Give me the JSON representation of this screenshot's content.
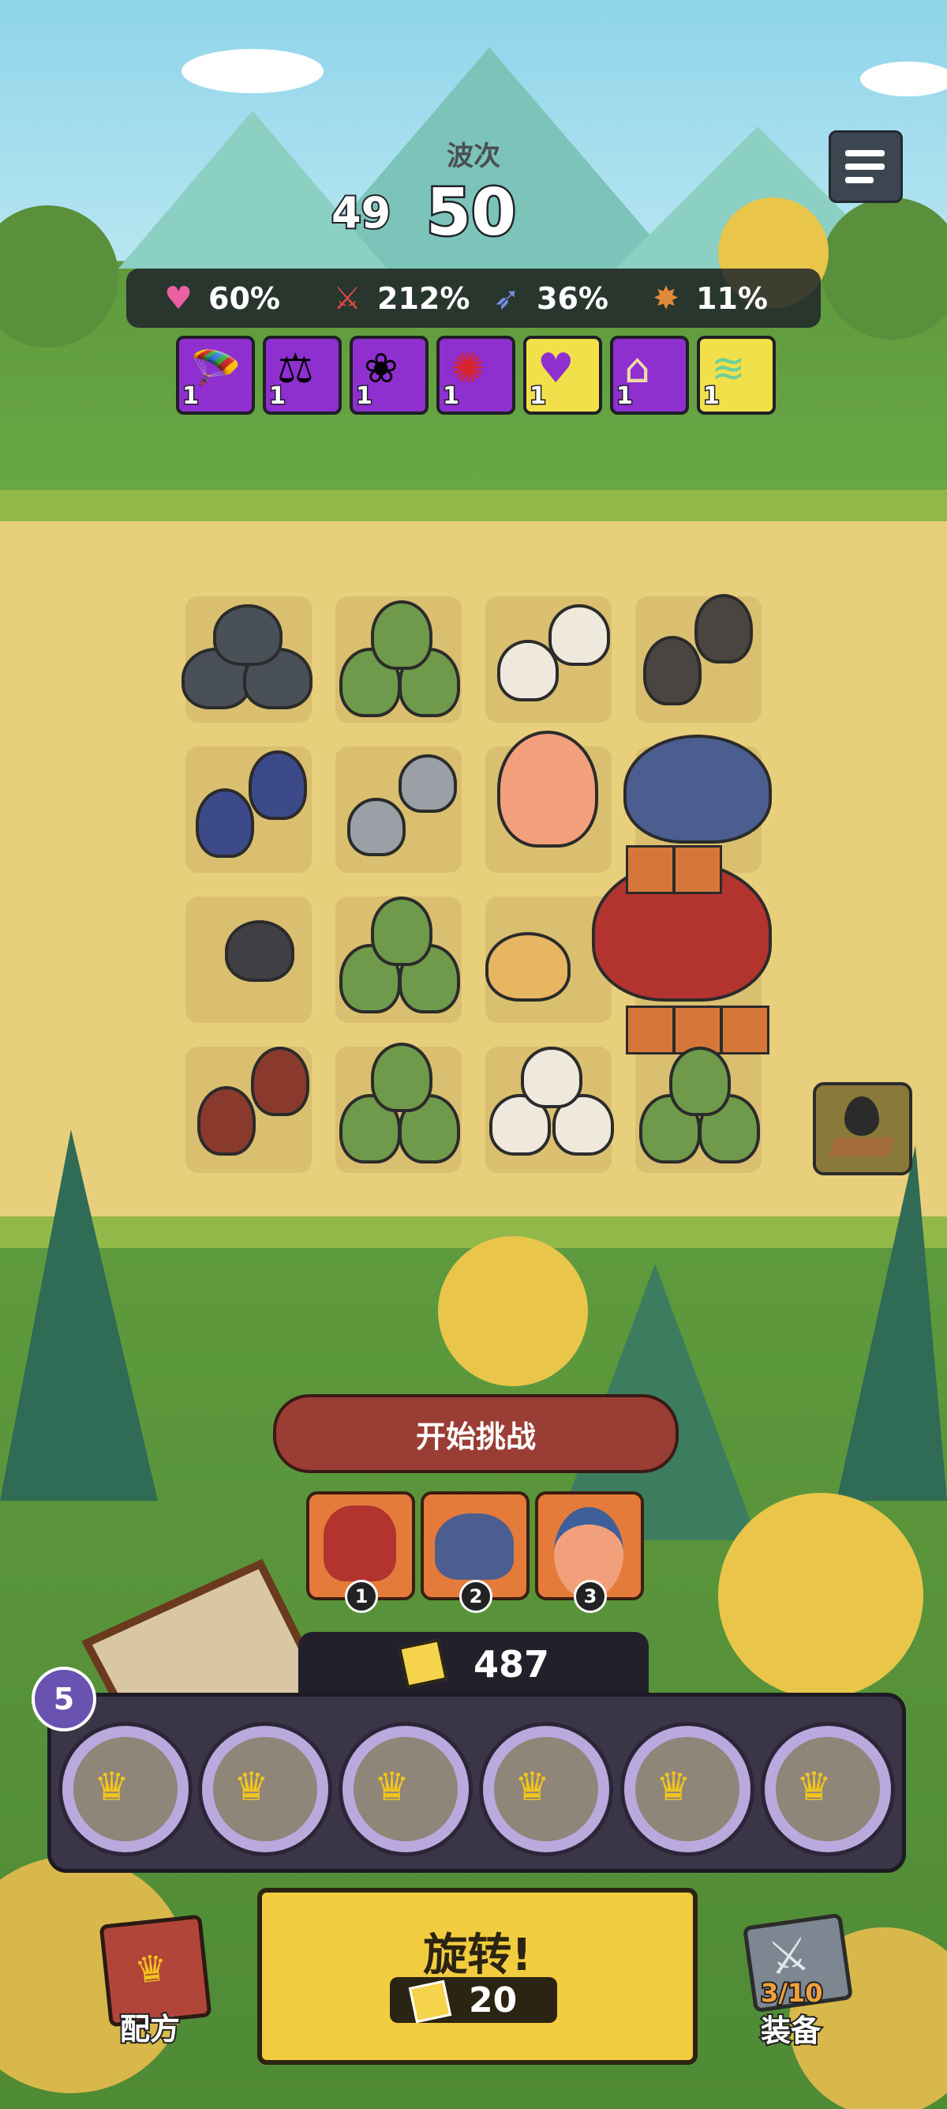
{
  "hud": {
    "wave_label": "波次",
    "wave_previous": "49",
    "wave_current": "50",
    "stats": [
      {
        "icon": "heart-icon",
        "value": "60%",
        "color": "#ec5fa0"
      },
      {
        "icon": "sword-icon",
        "value": "212%",
        "color": "#e04646"
      },
      {
        "icon": "boot-icon",
        "value": "36%",
        "color": "#7a8ee6"
      },
      {
        "icon": "burst-icon",
        "value": "11%",
        "color": "#e08a3a"
      }
    ],
    "buffs": [
      {
        "icon": "parachute-crate-icon",
        "count": "1",
        "bg": "#8f2fd0"
      },
      {
        "icon": "scales-icon",
        "count": "1",
        "bg": "#8f2fd0"
      },
      {
        "icon": "crowd-icon",
        "count": "1",
        "bg": "#8f2fd0"
      },
      {
        "icon": "blood-splash-icon",
        "count": "1",
        "bg": "#8f2fd0"
      },
      {
        "icon": "burst-heart-icon",
        "count": "1",
        "bg": "#f1e04a"
      },
      {
        "icon": "house-icon",
        "count": "1",
        "bg": "#8f2fd0"
      },
      {
        "icon": "wind-swirl-icon",
        "count": "1",
        "bg": "#f1e04a"
      }
    ]
  },
  "controls": {
    "start_button": "开始挑战",
    "upcoming": [
      {
        "name": "red-dragon-portrait",
        "number": "1"
      },
      {
        "name": "shark-portrait",
        "number": "2"
      },
      {
        "name": "mage-girl-portrait",
        "number": "3"
      }
    ],
    "gold": "487",
    "level": "5",
    "spin_label": "旋转!",
    "spin_cost": "20",
    "recipe_label": "配方",
    "equipment_label": "装备",
    "equipment_count": "3/10"
  },
  "colors": {
    "sky": "#8fd4ea",
    "sand": "#e8cf7c",
    "grass": "#5f9a3e",
    "start_button": "#9a3d34",
    "spin_button": "#f2cc3f",
    "tray": "#3b3647"
  }
}
